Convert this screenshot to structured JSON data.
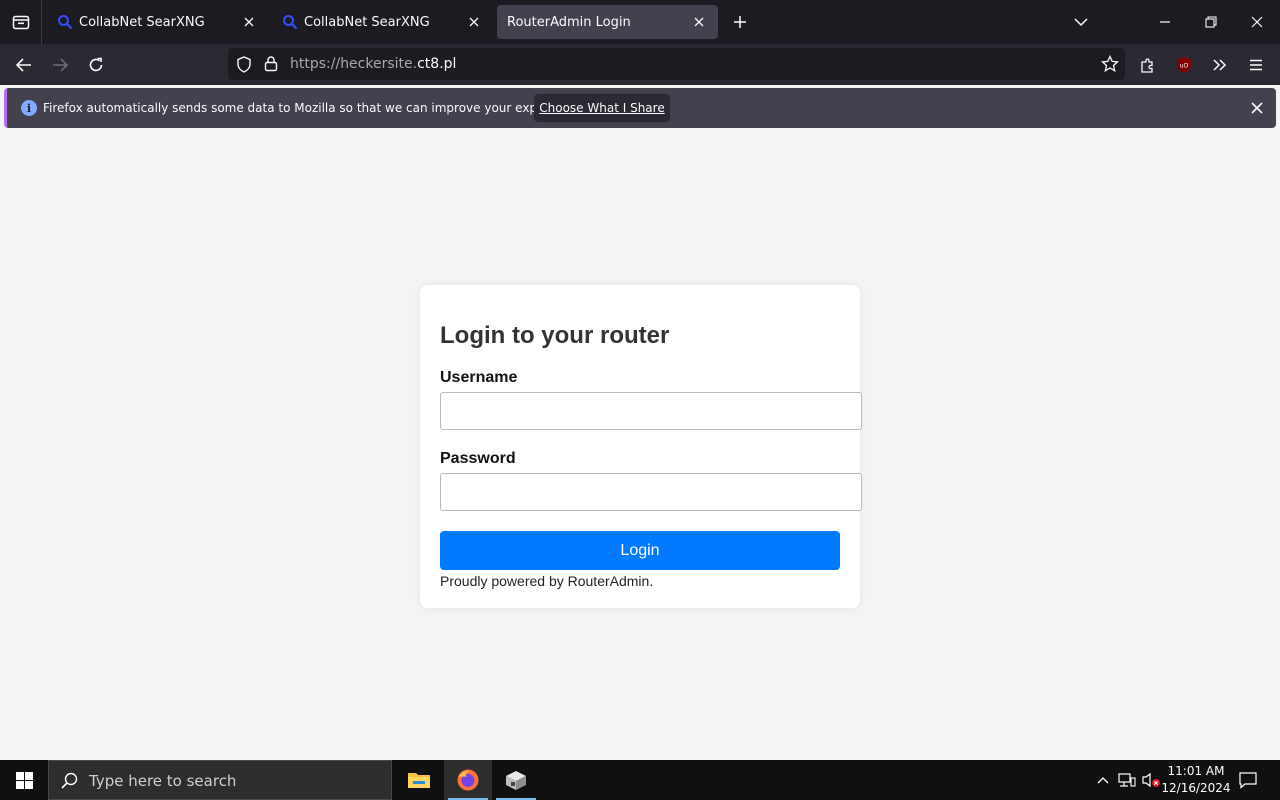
{
  "browser": {
    "tabs": [
      {
        "title": "CollabNet SearXNG",
        "active": false
      },
      {
        "title": "CollabNet SearXNG",
        "active": false
      },
      {
        "title": "RouterAdmin Login",
        "active": true
      }
    ],
    "url": {
      "scheme": "https://",
      "subdomain": "heckersite.",
      "domain": "ct8.pl"
    },
    "notification": {
      "message": "Firefox automatically sends some data to Mozilla so that we can improve your experience.",
      "button_label": "Choose What I Share"
    },
    "colors": {
      "tabbar": "#1c1b22",
      "toolbar": "#2b2a33",
      "active_tab": "#42414d",
      "accent": "#b56cf1"
    }
  },
  "page": {
    "heading": "Login to your router",
    "username_label": "Username",
    "username_value": "",
    "password_label": "Password",
    "password_value": "",
    "login_button": "Login",
    "footer": "Proudly powered by RouterAdmin.",
    "colors": {
      "background": "#f4f4f4",
      "button": "#007bff"
    }
  },
  "taskbar": {
    "search_placeholder": "Type here to search",
    "time": "11:01 AM",
    "date": "12/16/2024",
    "apps": [
      "file-explorer-icon",
      "firefox-icon",
      "package-app-icon"
    ]
  }
}
